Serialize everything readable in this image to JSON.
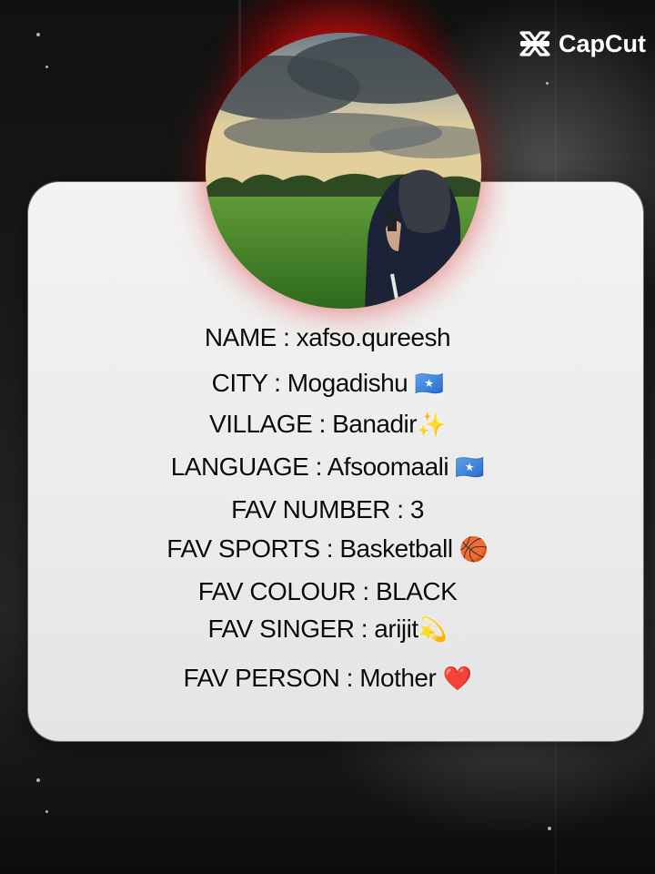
{
  "watermark": {
    "brand": "CapCut",
    "icon": "capcut-logo-icon"
  },
  "profile": {
    "avatar_description_icon": "profile-photo",
    "fields": [
      {
        "label": "NAME",
        "value": "xafso.qureesh",
        "emoji": ""
      },
      {
        "label": "CITY",
        "value": "Mogadishu",
        "emoji": "🇸🇴"
      },
      {
        "label": "VILLAGE",
        "value": "Banadir",
        "emoji": "✨"
      },
      {
        "label": "LANGUAGE",
        "value": "Afsoomaali",
        "emoji": "🇸🇴"
      },
      {
        "label": "FAV NUMBER",
        "value": "3",
        "emoji": ""
      },
      {
        "label": "FAV SPORTS",
        "value": "Basketball",
        "emoji": "🏀"
      },
      {
        "label": "FAV COLOUR",
        "value": "BLACK",
        "emoji": ""
      },
      {
        "label": "FAV SINGER",
        "value": "arijit",
        "emoji": "💫"
      },
      {
        "label": "FAV PERSON",
        "value": "Mother",
        "emoji": "❤️"
      }
    ]
  },
  "colors": {
    "card": "#eeeeee",
    "text": "#0a0a0a",
    "glow": "#c81414"
  }
}
